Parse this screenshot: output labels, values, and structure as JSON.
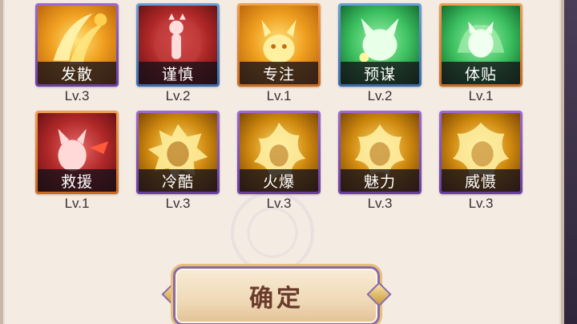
{
  "skills": [
    {
      "name": "发散",
      "level": "Lv.3",
      "frame": "#8a5cc4",
      "art": "gold",
      "icon": "swirl-flames-icon"
    },
    {
      "name": "谨慎",
      "level": "Lv.2",
      "frame": "#4f86c6",
      "art": "red",
      "icon": "cautious-creature-icon"
    },
    {
      "name": "专注",
      "level": "Lv.1",
      "frame": "#e08a3a",
      "art": "gold",
      "icon": "focused-creature-icon"
    },
    {
      "name": "预谋",
      "level": "Lv.2",
      "frame": "#4f86c6",
      "art": "green",
      "icon": "scheming-creature-icon"
    },
    {
      "name": "体贴",
      "level": "Lv.1",
      "frame": "#e08a3a",
      "art": "green",
      "icon": "caring-creature-icon"
    },
    {
      "name": "救援",
      "level": "Lv.1",
      "frame": "#e08a3a",
      "art": "red",
      "icon": "rescue-creature-icon"
    },
    {
      "name": "冷酷",
      "level": "Lv.3",
      "frame": "#8a5cc4",
      "art": "darkgold",
      "icon": "cold-creature-icon"
    },
    {
      "name": "火爆",
      "level": "Lv.3",
      "frame": "#8a5cc4",
      "art": "darkgold",
      "icon": "fiery-creature-icon"
    },
    {
      "name": "魅力",
      "level": "Lv.3",
      "frame": "#8a5cc4",
      "art": "darkgold",
      "icon": "charm-creature-icon"
    },
    {
      "name": "威慑",
      "level": "Lv.3",
      "frame": "#8a5cc4",
      "art": "darkgold",
      "icon": "intimidate-creature-icon"
    }
  ],
  "confirm_button": {
    "label": "确定"
  },
  "colors": {
    "panel_bg": "#f4ebe3",
    "text_dark": "#3a3036",
    "button_text": "#6a3a2a"
  }
}
